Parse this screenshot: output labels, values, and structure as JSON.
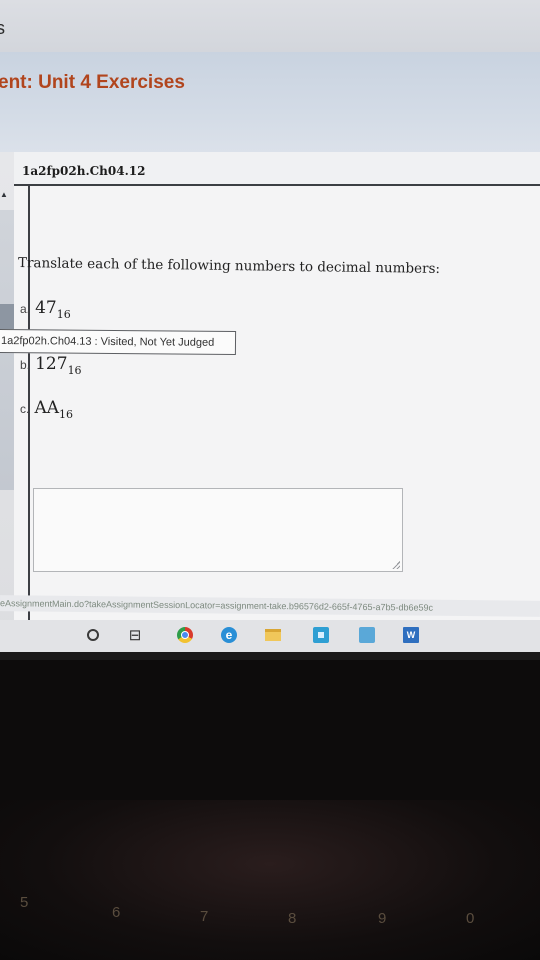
{
  "header": {
    "top_cut_text": "s",
    "assignment_title": "ent: Unit 4 Exercises"
  },
  "question": {
    "id": "1a2fp02h.Ch04.12",
    "prompt": "Translate each of the following numbers to decimal numbers:",
    "items": [
      {
        "label": "a.",
        "number": "47",
        "base": "16"
      },
      {
        "label": "b.",
        "number": "127",
        "base": "16"
      },
      {
        "label": "c.",
        "number": "AA",
        "base": "16"
      }
    ]
  },
  "tooltip": {
    "text": "1a2fp02h.Ch04.13 : Visited, Not Yet Judged"
  },
  "status_url": "eAssignmentMain.do?takeAssignmentSessionLocator=assignment-take.b96576d2-665f-4765-a7b5-db6e59c",
  "taskbar": {
    "icons": [
      "start-circle-icon",
      "task-view-icon",
      "chrome-icon",
      "edge-icon",
      "file-explorer-icon",
      "store-icon",
      "app-icon",
      "word-icon"
    ],
    "word_label": "W",
    "edge_label": "e"
  },
  "keyboard": {
    "keys": [
      "5",
      "6",
      "7",
      "8",
      "9",
      "0"
    ]
  }
}
